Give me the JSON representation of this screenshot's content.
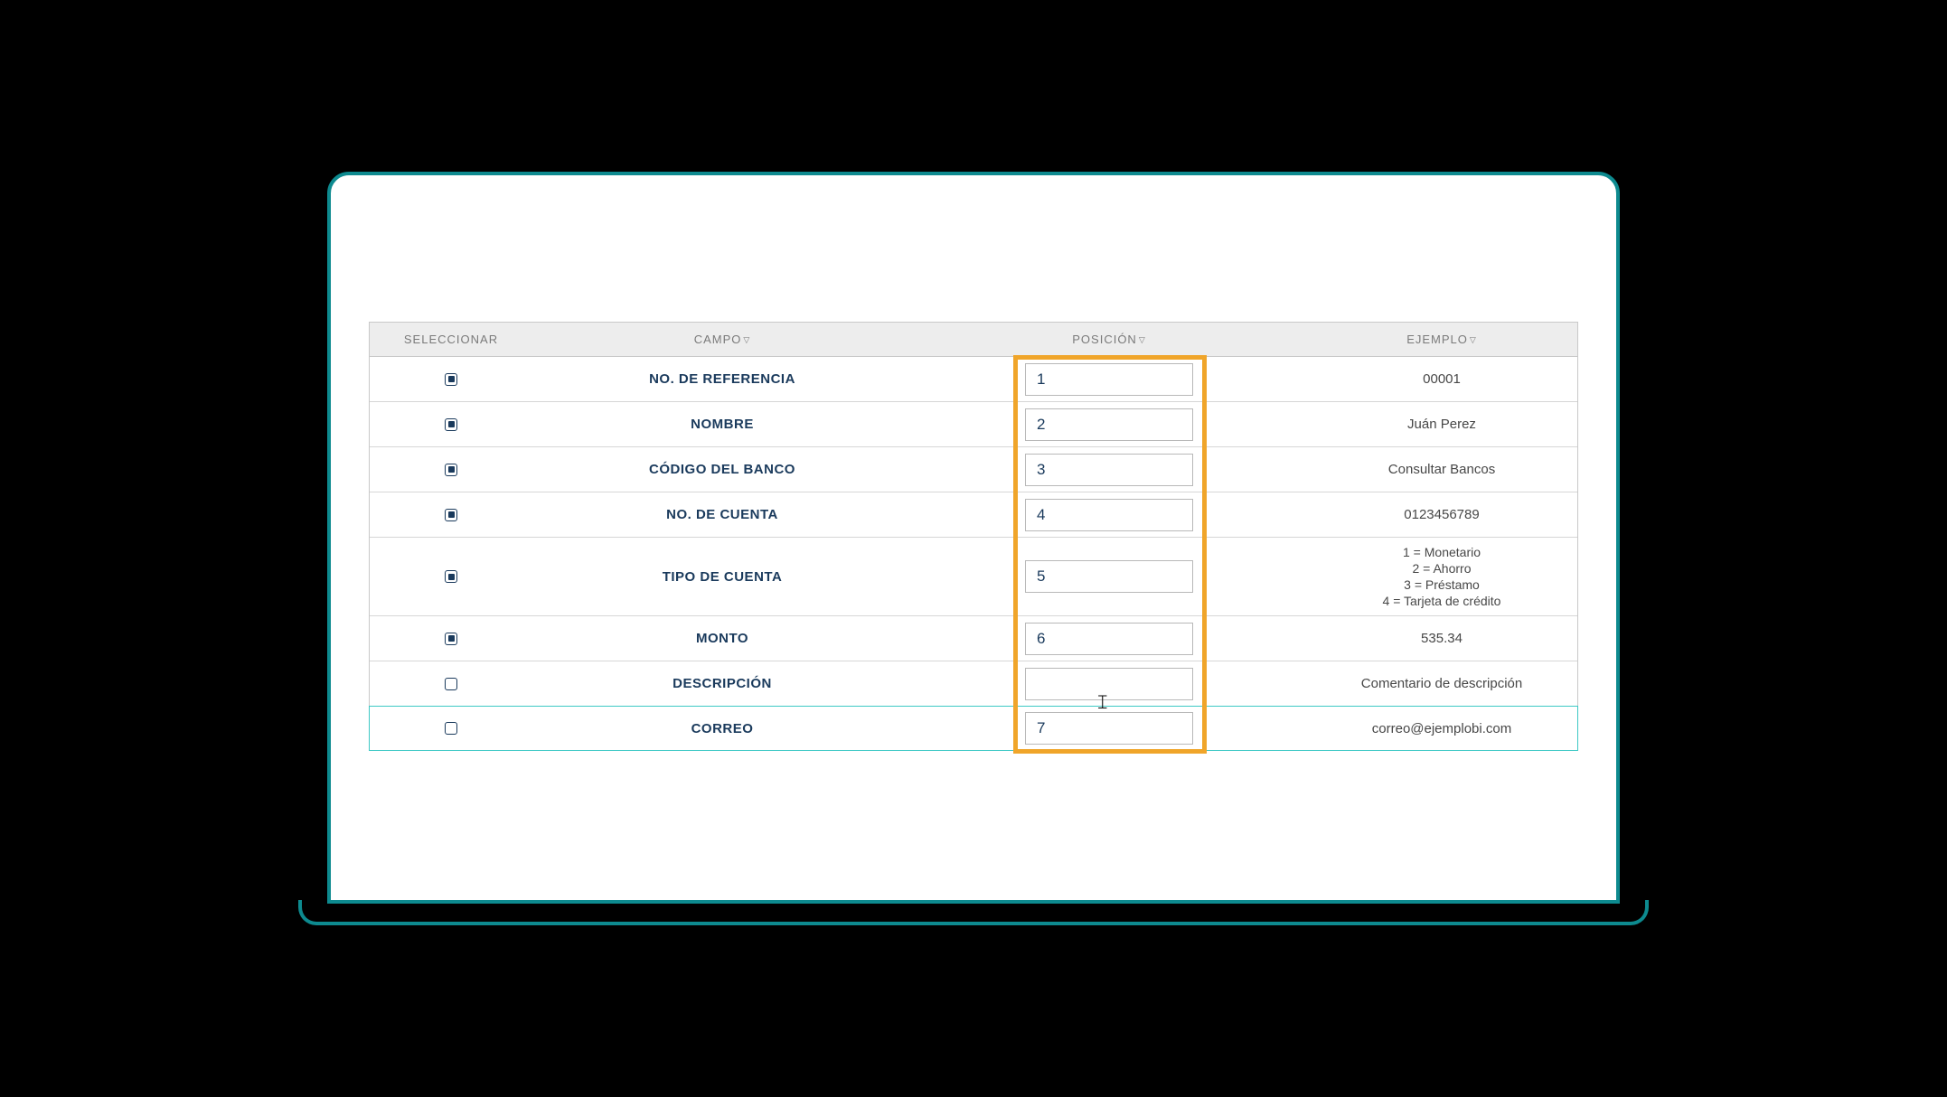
{
  "headers": {
    "seleccionar": "SELECCIONAR",
    "campo": "CAMPO",
    "posicion": "POSICIÓN",
    "ejemplo": "EJEMPLO"
  },
  "rows": [
    {
      "checked": true,
      "campo": "NO. DE REFERENCIA",
      "posicion": "1",
      "ejemplo": "00001"
    },
    {
      "checked": true,
      "campo": "NOMBRE",
      "posicion": "2",
      "ejemplo": "Juán Perez"
    },
    {
      "checked": true,
      "campo": "CÓDIGO DEL BANCO",
      "posicion": "3",
      "ejemplo": "Consultar Bancos"
    },
    {
      "checked": true,
      "campo": "NO. DE CUENTA",
      "posicion": "4",
      "ejemplo": "0123456789"
    },
    {
      "checked": true,
      "campo": "TIPO DE CUENTA",
      "posicion": "5",
      "ejemplo_multi": [
        "1 = Monetario",
        "2 = Ahorro",
        "3 = Préstamo",
        "4 = Tarjeta de crédito"
      ]
    },
    {
      "checked": true,
      "campo": "MONTO",
      "posicion": "6",
      "ejemplo": "535.34"
    },
    {
      "checked": false,
      "campo": "DESCRIPCIÓN",
      "posicion": "",
      "ejemplo": "Comentario de descripción"
    },
    {
      "checked": false,
      "campo": "CORREO",
      "posicion": "7",
      "ejemplo": "correo@ejemplobi.com",
      "highlight": true
    }
  ],
  "colors": {
    "frame": "#0d8a8f",
    "highlight": "#f0a52a",
    "primary": "#1a3a5c"
  }
}
